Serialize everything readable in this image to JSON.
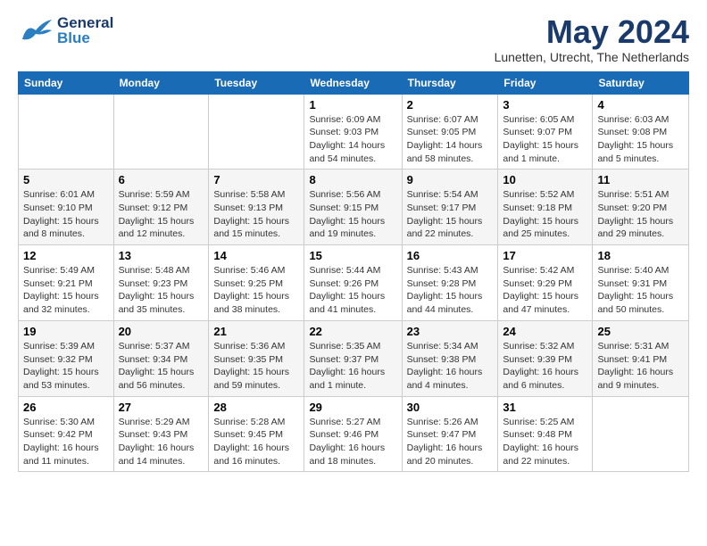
{
  "header": {
    "logo_general": "General",
    "logo_blue": "Blue",
    "month": "May 2024",
    "location": "Lunetten, Utrecht, The Netherlands"
  },
  "days_of_week": [
    "Sunday",
    "Monday",
    "Tuesday",
    "Wednesday",
    "Thursday",
    "Friday",
    "Saturday"
  ],
  "weeks": [
    [
      {
        "day": "",
        "info": ""
      },
      {
        "day": "",
        "info": ""
      },
      {
        "day": "",
        "info": ""
      },
      {
        "day": "1",
        "info": "Sunrise: 6:09 AM\nSunset: 9:03 PM\nDaylight: 14 hours\nand 54 minutes."
      },
      {
        "day": "2",
        "info": "Sunrise: 6:07 AM\nSunset: 9:05 PM\nDaylight: 14 hours\nand 58 minutes."
      },
      {
        "day": "3",
        "info": "Sunrise: 6:05 AM\nSunset: 9:07 PM\nDaylight: 15 hours\nand 1 minute."
      },
      {
        "day": "4",
        "info": "Sunrise: 6:03 AM\nSunset: 9:08 PM\nDaylight: 15 hours\nand 5 minutes."
      }
    ],
    [
      {
        "day": "5",
        "info": "Sunrise: 6:01 AM\nSunset: 9:10 PM\nDaylight: 15 hours\nand 8 minutes."
      },
      {
        "day": "6",
        "info": "Sunrise: 5:59 AM\nSunset: 9:12 PM\nDaylight: 15 hours\nand 12 minutes."
      },
      {
        "day": "7",
        "info": "Sunrise: 5:58 AM\nSunset: 9:13 PM\nDaylight: 15 hours\nand 15 minutes."
      },
      {
        "day": "8",
        "info": "Sunrise: 5:56 AM\nSunset: 9:15 PM\nDaylight: 15 hours\nand 19 minutes."
      },
      {
        "day": "9",
        "info": "Sunrise: 5:54 AM\nSunset: 9:17 PM\nDaylight: 15 hours\nand 22 minutes."
      },
      {
        "day": "10",
        "info": "Sunrise: 5:52 AM\nSunset: 9:18 PM\nDaylight: 15 hours\nand 25 minutes."
      },
      {
        "day": "11",
        "info": "Sunrise: 5:51 AM\nSunset: 9:20 PM\nDaylight: 15 hours\nand 29 minutes."
      }
    ],
    [
      {
        "day": "12",
        "info": "Sunrise: 5:49 AM\nSunset: 9:21 PM\nDaylight: 15 hours\nand 32 minutes."
      },
      {
        "day": "13",
        "info": "Sunrise: 5:48 AM\nSunset: 9:23 PM\nDaylight: 15 hours\nand 35 minutes."
      },
      {
        "day": "14",
        "info": "Sunrise: 5:46 AM\nSunset: 9:25 PM\nDaylight: 15 hours\nand 38 minutes."
      },
      {
        "day": "15",
        "info": "Sunrise: 5:44 AM\nSunset: 9:26 PM\nDaylight: 15 hours\nand 41 minutes."
      },
      {
        "day": "16",
        "info": "Sunrise: 5:43 AM\nSunset: 9:28 PM\nDaylight: 15 hours\nand 44 minutes."
      },
      {
        "day": "17",
        "info": "Sunrise: 5:42 AM\nSunset: 9:29 PM\nDaylight: 15 hours\nand 47 minutes."
      },
      {
        "day": "18",
        "info": "Sunrise: 5:40 AM\nSunset: 9:31 PM\nDaylight: 15 hours\nand 50 minutes."
      }
    ],
    [
      {
        "day": "19",
        "info": "Sunrise: 5:39 AM\nSunset: 9:32 PM\nDaylight: 15 hours\nand 53 minutes."
      },
      {
        "day": "20",
        "info": "Sunrise: 5:37 AM\nSunset: 9:34 PM\nDaylight: 15 hours\nand 56 minutes."
      },
      {
        "day": "21",
        "info": "Sunrise: 5:36 AM\nSunset: 9:35 PM\nDaylight: 15 hours\nand 59 minutes."
      },
      {
        "day": "22",
        "info": "Sunrise: 5:35 AM\nSunset: 9:37 PM\nDaylight: 16 hours\nand 1 minute."
      },
      {
        "day": "23",
        "info": "Sunrise: 5:34 AM\nSunset: 9:38 PM\nDaylight: 16 hours\nand 4 minutes."
      },
      {
        "day": "24",
        "info": "Sunrise: 5:32 AM\nSunset: 9:39 PM\nDaylight: 16 hours\nand 6 minutes."
      },
      {
        "day": "25",
        "info": "Sunrise: 5:31 AM\nSunset: 9:41 PM\nDaylight: 16 hours\nand 9 minutes."
      }
    ],
    [
      {
        "day": "26",
        "info": "Sunrise: 5:30 AM\nSunset: 9:42 PM\nDaylight: 16 hours\nand 11 minutes."
      },
      {
        "day": "27",
        "info": "Sunrise: 5:29 AM\nSunset: 9:43 PM\nDaylight: 16 hours\nand 14 minutes."
      },
      {
        "day": "28",
        "info": "Sunrise: 5:28 AM\nSunset: 9:45 PM\nDaylight: 16 hours\nand 16 minutes."
      },
      {
        "day": "29",
        "info": "Sunrise: 5:27 AM\nSunset: 9:46 PM\nDaylight: 16 hours\nand 18 minutes."
      },
      {
        "day": "30",
        "info": "Sunrise: 5:26 AM\nSunset: 9:47 PM\nDaylight: 16 hours\nand 20 minutes."
      },
      {
        "day": "31",
        "info": "Sunrise: 5:25 AM\nSunset: 9:48 PM\nDaylight: 16 hours\nand 22 minutes."
      },
      {
        "day": "",
        "info": ""
      }
    ]
  ]
}
